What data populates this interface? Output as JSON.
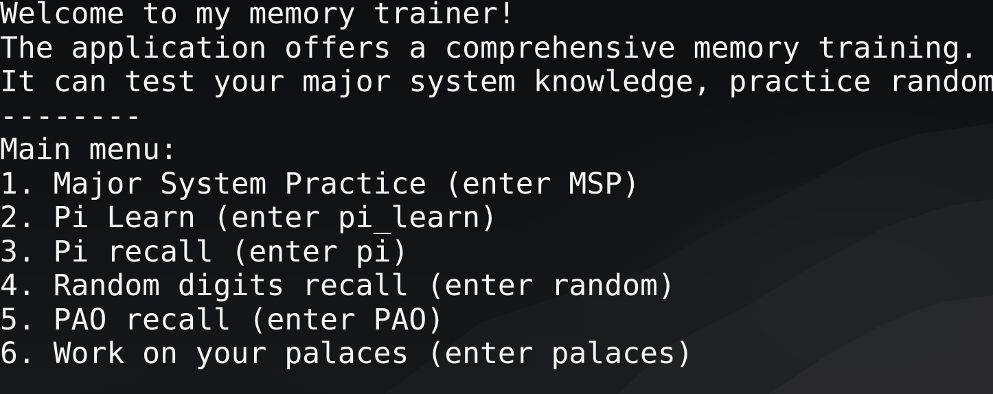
{
  "terminal": {
    "lines": {
      "welcome": "Welcome to my memory trainer!",
      "description_1": "The application offers a comprehensive memory training.",
      "description_2": "It can test your major system knowledge, practice random",
      "separator": "--------",
      "menu_title": "Main menu:",
      "option_1": "1. Major System Practice (enter MSP)",
      "option_2": "2. Pi Learn (enter pi_learn)",
      "option_3": "3. Pi recall (enter pi)",
      "option_4": "4. Random digits recall (enter random)",
      "option_5": "5. PAO recall (enter PAO)",
      "option_6": "6. Work on your palaces (enter palaces)"
    },
    "colors": {
      "text": "#f3f3f3",
      "background": "#0f1013"
    }
  }
}
